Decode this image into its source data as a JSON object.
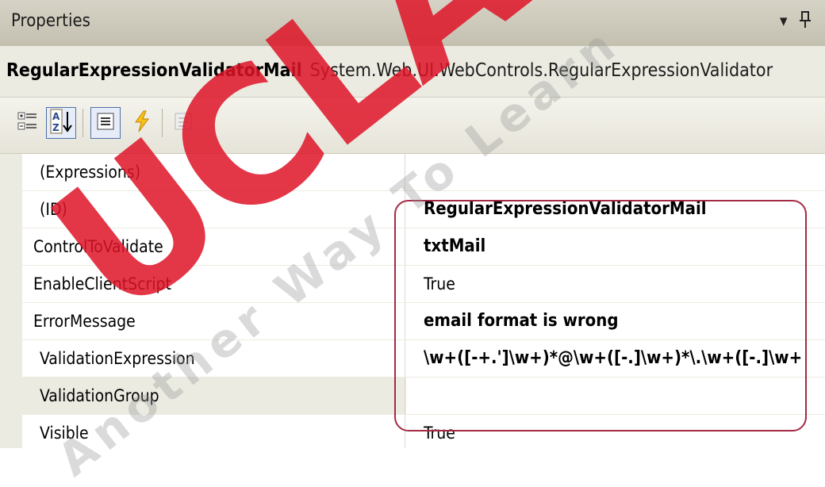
{
  "panel": {
    "title": "Properties",
    "dropdown_glyph": "▾",
    "pin_glyph": "ꟷ"
  },
  "object": {
    "name": "RegularExpressionValidatorMail",
    "type": "System.Web.UI.WebControls.RegularExpressionValidator"
  },
  "toolbar": {
    "buttons": [
      {
        "icon": "categorized-icon",
        "pressed": false
      },
      {
        "icon": "alphabetical-sort-icon",
        "pressed": true
      },
      {
        "icon": "properties-icon",
        "pressed": true
      },
      {
        "icon": "events-icon",
        "pressed": false
      },
      {
        "icon": "property-pages-icon",
        "pressed": false
      }
    ]
  },
  "properties": [
    {
      "name": "(Expressions)",
      "value": "",
      "value_bold": false
    },
    {
      "name": "(ID)",
      "value": "RegularExpressionValidatorMail",
      "value_bold": true
    },
    {
      "name": "ControlToValidate",
      "value": "txtMail",
      "value_bold": true
    },
    {
      "name": "EnableClientScript",
      "value": "True",
      "value_bold": false
    },
    {
      "name": "ErrorMessage",
      "value": "email format is wrong",
      "value_bold": true
    },
    {
      "name": "ValidationExpression",
      "value": "\\w+([-+.']\\w+)*@\\w+([-.]\\w+)*\\.\\w+([-.]\\w+",
      "value_bold": true
    },
    {
      "name": "ValidationGroup",
      "value": "",
      "value_bold": false
    },
    {
      "name": "Visible",
      "value": "True",
      "value_bold": false
    }
  ],
  "watermark": {
    "big_text": "UCLAS",
    "small_text": "Another Way To Learn"
  },
  "colors": {
    "highlight_border": "#a52a45",
    "watermark_red": "#de1428",
    "pressed_border": "#4e6fa6"
  }
}
